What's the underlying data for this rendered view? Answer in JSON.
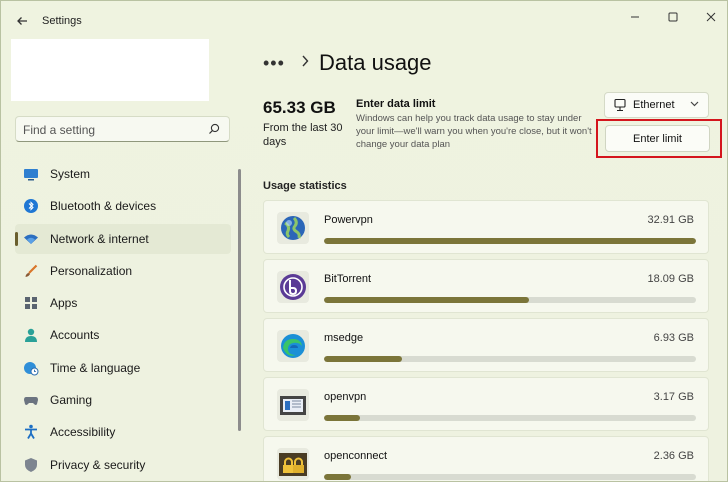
{
  "window": {
    "title": "Settings"
  },
  "search": {
    "placeholder": "Find a setting"
  },
  "nav": {
    "items": [
      {
        "label": "System",
        "icon": "monitor-icon",
        "active": false
      },
      {
        "label": "Bluetooth & devices",
        "icon": "bluetooth-icon",
        "active": false
      },
      {
        "label": "Network & internet",
        "icon": "wifi-icon",
        "active": true
      },
      {
        "label": "Personalization",
        "icon": "brush-icon",
        "active": false
      },
      {
        "label": "Apps",
        "icon": "apps-icon",
        "active": false
      },
      {
        "label": "Accounts",
        "icon": "person-icon",
        "active": false
      },
      {
        "label": "Time & language",
        "icon": "globe-clock-icon",
        "active": false
      },
      {
        "label": "Gaming",
        "icon": "gamepad-icon",
        "active": false
      },
      {
        "label": "Accessibility",
        "icon": "accessibility-icon",
        "active": false
      },
      {
        "label": "Privacy & security",
        "icon": "shield-icon",
        "active": false
      }
    ]
  },
  "header": {
    "breadcrumb_more": "•••",
    "title": "Data usage"
  },
  "summary": {
    "total": "65.33 GB",
    "period": "From the last 30 days"
  },
  "limit": {
    "title": "Enter data limit",
    "description": "Windows can help you track data usage to stay under your limit—we'll warn you when you're close, but it won't change your data plan",
    "button_label": "Enter limit"
  },
  "network_select": {
    "value": "Ethernet"
  },
  "usage": {
    "section_label": "Usage statistics",
    "apps": [
      {
        "name": "Powervpn",
        "size": "32.91 GB",
        "fraction": 1.0,
        "icon": "powervpn-globe-icon"
      },
      {
        "name": "BitTorrent",
        "size": "18.09 GB",
        "fraction": 0.55,
        "icon": "bittorrent-icon"
      },
      {
        "name": "msedge",
        "size": "6.93 GB",
        "fraction": 0.21,
        "icon": "edge-icon"
      },
      {
        "name": "openvpn",
        "size": "3.17 GB",
        "fraction": 0.096,
        "icon": "openvpn-icon"
      },
      {
        "name": "openconnect",
        "size": "2.36 GB",
        "fraction": 0.072,
        "icon": "openconnect-icon"
      }
    ]
  },
  "colors": {
    "accent_bar": "#7b7539",
    "highlight": "#d4151d"
  }
}
